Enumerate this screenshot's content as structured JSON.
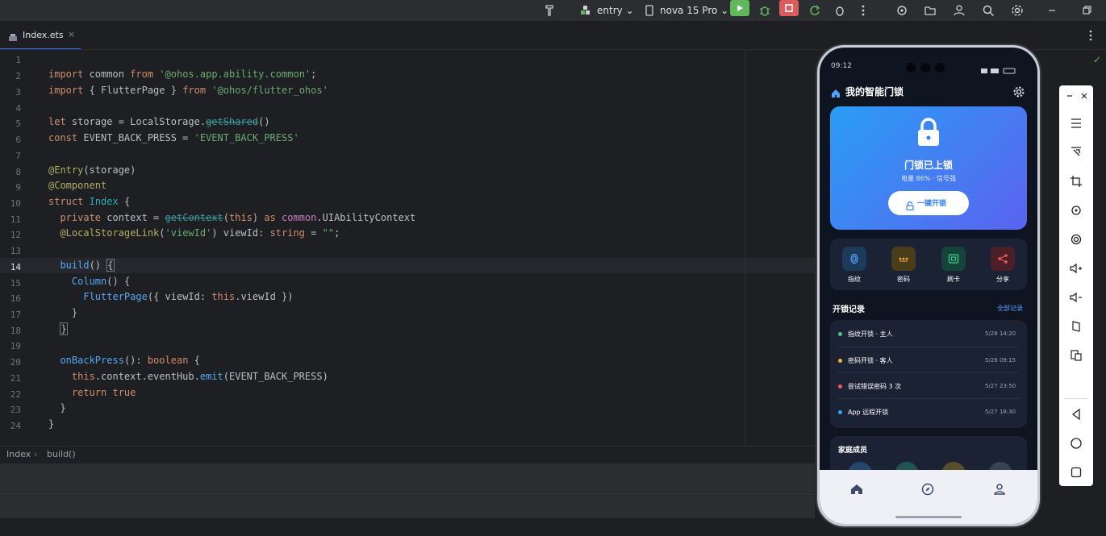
{
  "toolbar": {
    "run_config": "entry",
    "device": "nova 15 Pro",
    "colors": {
      "run_green": "#5fb85c",
      "stop_red": "#db5c5c",
      "bg": "#2b2d30"
    }
  },
  "tab": {
    "filename": "Index.ets"
  },
  "editor": {
    "line_numbers": [
      "1",
      "2",
      "3",
      "4",
      "5",
      "6",
      "7",
      "8",
      "9",
      "10",
      "11",
      "12",
      "13",
      "14",
      "15",
      "16",
      "17",
      "18",
      "19",
      "20",
      "21",
      "22",
      "23",
      "24"
    ],
    "current_line": "14"
  },
  "breadcrumb": {
    "items": [
      "Index",
      "build()"
    ]
  },
  "phone": {
    "status_time": "09:12",
    "app_title": "我的智能门锁",
    "lock_status": "门锁已上锁",
    "lock_info": "电量 86% · 信号强",
    "unlock_button": "一键开锁",
    "quick_actions": [
      "指纹",
      "密码",
      "刷卡",
      "分享"
    ],
    "records_title": "开锁记录",
    "records_link": "全部记录",
    "records": [
      {
        "text": "指纹开锁 · 主人",
        "time": "5/28 14:20",
        "color": "#3ecf8e"
      },
      {
        "text": "密码开锁 · 客人",
        "time": "5/28 09:15",
        "color": "#f5b532"
      },
      {
        "text": "尝试错误密码 3 次",
        "time": "5/27 23:50",
        "color": "#f05a5a"
      },
      {
        "text": "App 远程开锁",
        "time": "5/27 18:30",
        "color": "#3aa0f0"
      }
    ],
    "family_title": "家庭成员",
    "colors": {
      "card_gradient_start": "#2a9df4",
      "card_gradient_end": "#5b63f0",
      "bg": "#0f1520",
      "card": "#1a2233"
    }
  }
}
